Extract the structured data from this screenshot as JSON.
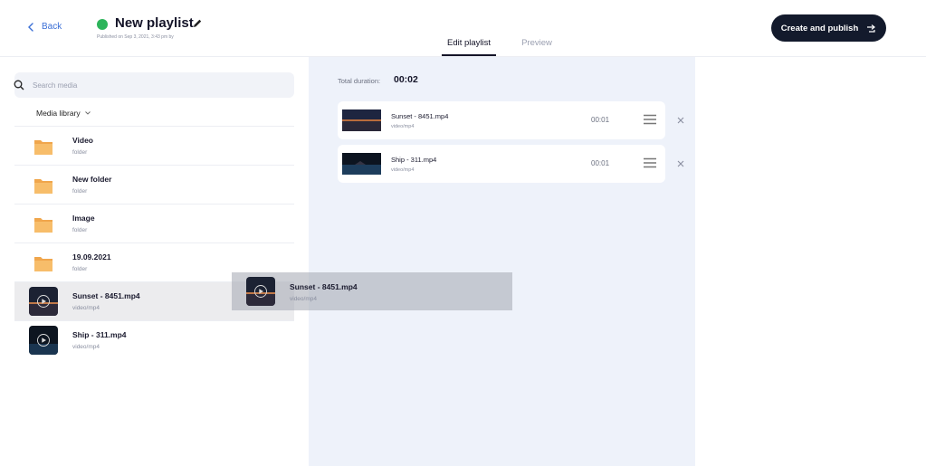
{
  "header": {
    "back_label": "Back",
    "title": "New playlist",
    "subtitle": "Published on Sep 3, 2021, 3:43 pm by",
    "status_color": "#2db45b",
    "publish_label": "Create and publish"
  },
  "tabs": [
    {
      "label": "Edit playlist",
      "active": true
    },
    {
      "label": "Preview",
      "active": false
    }
  ],
  "sidebar": {
    "search_placeholder": "Search media",
    "library_label": "Media library",
    "items": [
      {
        "name": "Video",
        "type": "folder",
        "icon": "folder-icon"
      },
      {
        "name": "New folder",
        "type": "folder",
        "icon": "folder-icon"
      },
      {
        "name": "Image",
        "type": "folder",
        "icon": "folder-icon"
      },
      {
        "name": "19.09.2021",
        "type": "folder",
        "icon": "folder-icon"
      },
      {
        "name": "Sunset - 8451.mp4",
        "type": "video/mp4",
        "icon": "play-icon",
        "selected": true
      },
      {
        "name": "Ship - 311.mp4",
        "type": "video/mp4",
        "icon": "play-icon"
      }
    ]
  },
  "drag_preview": {
    "name": "Sunset - 8451.mp4",
    "type": "video/mp4"
  },
  "playlist": {
    "duration_label": "Total duration:",
    "duration_value": "00:02",
    "items": [
      {
        "name": "Sunset - 8451.mp4",
        "type": "video/mp4",
        "duration": "00:01"
      },
      {
        "name": "Ship - 311.mp4",
        "type": "video/mp4",
        "duration": "00:01"
      }
    ]
  },
  "colors": {
    "accent": "#3b6fd6",
    "folder": "#f5b55f",
    "dark": "#131a2c",
    "canvas": "#eef2fa"
  }
}
